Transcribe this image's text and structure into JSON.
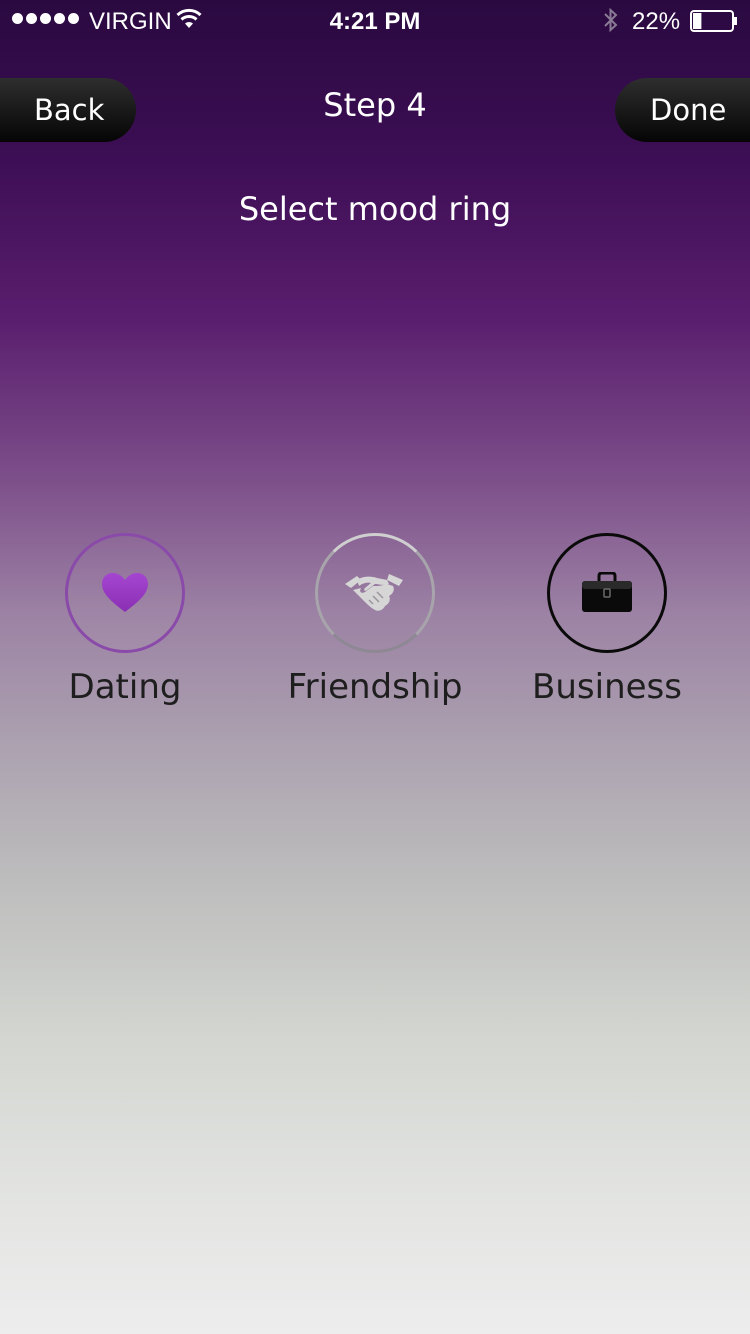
{
  "status_bar": {
    "carrier": "VIRGIN",
    "time": "4:21 PM",
    "battery_percent": "22%",
    "signal_icon": "signal-dots-icon",
    "wifi_icon": "wifi-icon",
    "bluetooth_icon": "bluetooth-icon",
    "battery_icon": "battery-icon",
    "battery_level": 0.22
  },
  "nav": {
    "back_label": "Back",
    "title": "Step 4",
    "done_label": "Done"
  },
  "subtitle": "Select mood ring",
  "mood_rings": [
    {
      "label": "Dating",
      "icon": "heart-icon",
      "color": "#9b3fc0"
    },
    {
      "label": "Friendship",
      "icon": "handshake-icon",
      "color": "#d6d6d6"
    },
    {
      "label": "Business",
      "icon": "briefcase-icon",
      "color": "#0a0a0a"
    }
  ],
  "colors": {
    "accent_purple": "#8a4aa9",
    "nav_button": "#111111",
    "top_gradient": "#2a0940",
    "bottom_gradient": "#ededed"
  }
}
